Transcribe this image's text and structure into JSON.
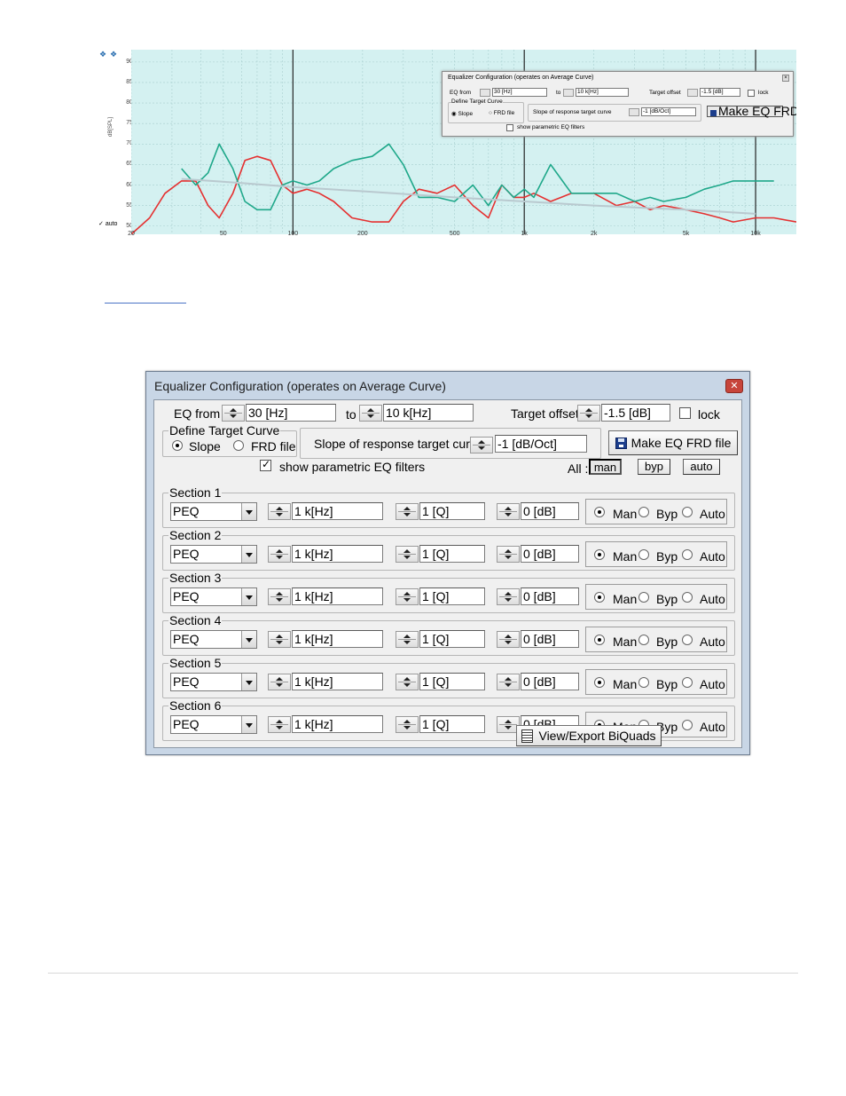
{
  "chart_data": {
    "type": "line",
    "xlabel": "",
    "ylabel": "dB[SPL]",
    "x_scale": "log",
    "xlim": [
      20,
      15000
    ],
    "ylim": [
      48,
      93
    ],
    "y_ticks": [
      "90",
      "85",
      "80",
      "75",
      "70",
      "65",
      "60",
      "55",
      "50"
    ],
    "x_ticks": [
      "20",
      "50",
      "100",
      "200",
      "500",
      "1k",
      "2k",
      "5k",
      "10k"
    ],
    "grid": true,
    "series": [
      {
        "color": "#e53030",
        "x": [
          20,
          24,
          28,
          33,
          38,
          43,
          48,
          55,
          62,
          70,
          80,
          90,
          100,
          115,
          130,
          150,
          180,
          220,
          260,
          300,
          350,
          420,
          500,
          600,
          700,
          800,
          900,
          1000,
          1100,
          1300,
          1600,
          2000,
          2500,
          3000,
          3500,
          4000,
          5000,
          6000,
          7000,
          8000,
          10000,
          12000,
          15000
        ],
        "y": [
          48,
          52,
          58,
          61,
          61,
          55,
          52,
          58,
          66,
          67,
          66,
          60,
          58,
          59,
          58,
          56,
          52,
          51,
          51,
          56,
          59,
          58,
          60,
          55,
          52,
          60,
          57,
          57,
          58,
          56,
          58,
          58,
          55,
          56,
          54,
          55,
          54,
          53,
          52,
          51,
          52,
          52,
          51
        ]
      },
      {
        "color": "#1fa88a",
        "x": [
          33,
          38,
          43,
          48,
          55,
          62,
          70,
          80,
          90,
          100,
          115,
          130,
          150,
          180,
          220,
          260,
          300,
          350,
          420,
          500,
          600,
          700,
          800,
          900,
          1000,
          1100,
          1300,
          1600,
          2000,
          2500,
          3000,
          3500,
          4000,
          5000,
          6000,
          7000,
          8000,
          10000,
          12000
        ],
        "y": [
          64,
          60,
          63,
          70,
          64,
          56,
          54,
          54,
          60,
          61,
          60,
          61,
          64,
          66,
          67,
          70,
          65,
          57,
          57,
          56,
          60,
          55,
          60,
          57,
          59,
          57,
          65,
          58,
          58,
          58,
          56,
          57,
          56,
          57,
          59,
          60,
          61,
          61,
          61
        ]
      },
      {
        "color": "#b9c9cf",
        "x": [
          33,
          60,
          100,
          200,
          500,
          1000,
          2000,
          5000,
          10000
        ],
        "y": [
          61.5,
          60.5,
          59.5,
          58.5,
          57,
          56,
          55,
          54,
          53
        ]
      }
    ]
  },
  "top_panel": {
    "legend_auto": "auto",
    "mini_dialog": {
      "title": "Equalizer Configuration (operates on Average Curve)",
      "eq_from_label": "EQ from",
      "eq_from_value": "30 [Hz]",
      "to_label": "to",
      "to_value": "10 k[Hz]",
      "target_offset_label": "Target offset",
      "target_offset_value": "-1.5 [dB]",
      "lock_label": "lock",
      "define_target": "Define Target Curve",
      "slope_label": "Slope",
      "frd_label": "FRD file",
      "slope_resp_label": "Slope of response target curve",
      "slope_resp_value": "-1 [dB/Oct]",
      "make_eq_label": "Make EQ FRD file",
      "show_filters_label": "show parametric EQ filters"
    }
  },
  "dialog": {
    "title": "Equalizer Configuration (operates on Average Curve)",
    "eq_from_label": "EQ from",
    "eq_from_value": "30 [Hz]",
    "to_label": "to",
    "to_value": "10 k[Hz]",
    "target_offset_label": "Target offset",
    "target_offset_value": "-1.5 [dB]",
    "lock_label": "lock",
    "define_target_label": "Define Target Curve",
    "slope_label": "Slope",
    "frd_label": "FRD file",
    "slope_resp_label": "Slope of response target curve",
    "slope_resp_value": "-1 [dB/Oct]",
    "make_eq_label": "Make EQ FRD file",
    "show_filters_label": "show parametric EQ filters",
    "all_label": "All :",
    "all_man": "man",
    "all_byp": "byp",
    "all_auto": "auto",
    "sections": [
      {
        "label": "Section 1",
        "type": "PEQ",
        "freq": "1 k[Hz]",
        "q": "1 [Q]",
        "gain": "0 [dB]",
        "man": "Man",
        "byp": "Byp",
        "auto": "Auto"
      },
      {
        "label": "Section 2",
        "type": "PEQ",
        "freq": "1 k[Hz]",
        "q": "1 [Q]",
        "gain": "0 [dB]",
        "man": "Man",
        "byp": "Byp",
        "auto": "Auto"
      },
      {
        "label": "Section 3",
        "type": "PEQ",
        "freq": "1 k[Hz]",
        "q": "1 [Q]",
        "gain": "0 [dB]",
        "man": "Man",
        "byp": "Byp",
        "auto": "Auto"
      },
      {
        "label": "Section 4",
        "type": "PEQ",
        "freq": "1 k[Hz]",
        "q": "1 [Q]",
        "gain": "0 [dB]",
        "man": "Man",
        "byp": "Byp",
        "auto": "Auto"
      },
      {
        "label": "Section 5",
        "type": "PEQ",
        "freq": "1 k[Hz]",
        "q": "1 [Q]",
        "gain": "0 [dB]",
        "man": "Man",
        "byp": "Byp",
        "auto": "Auto"
      },
      {
        "label": "Section 6",
        "type": "PEQ",
        "freq": "1 k[Hz]",
        "q": "1 [Q]",
        "gain": "0 [dB]",
        "man": "Man",
        "byp": "Byp",
        "auto": "Auto"
      }
    ],
    "export_label": "View/Export BiQuads"
  }
}
